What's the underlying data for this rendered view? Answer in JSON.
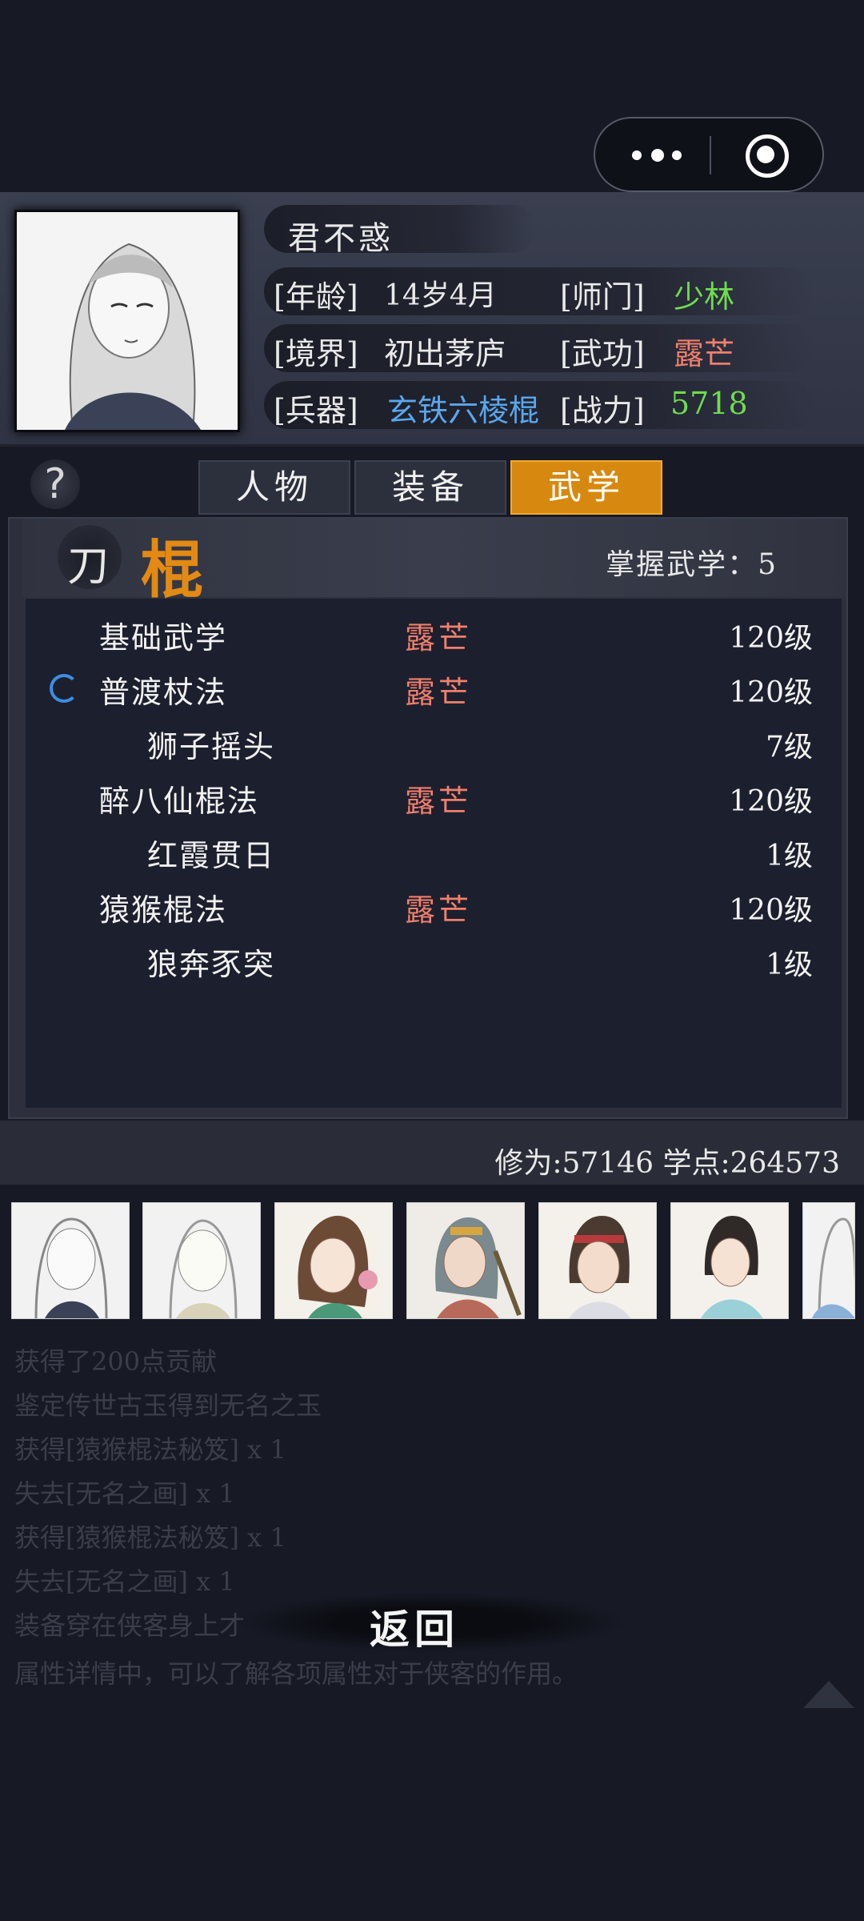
{
  "info": {
    "name": "君不惑",
    "age_label": "[年龄]",
    "age": "14岁4月",
    "sect_label": "[师门]",
    "sect": "少林",
    "realm_label": "[境界]",
    "realm": "初出茅庐",
    "kungfu_label": "[武功]",
    "kungfu": "露芒",
    "weapon_label": "[兵器]",
    "weapon": "玄铁六棱棍",
    "power_label": "[战力]",
    "power": "5718"
  },
  "tabs": [
    "人物",
    "装备",
    "武学"
  ],
  "active_tab": "武学",
  "weapon_types": [
    "刀",
    "棍"
  ],
  "mastered": "掌握武学：5",
  "skills": [
    {
      "name": "基础武学",
      "rank": "露芒",
      "level": "120级"
    },
    {
      "name": "普渡杖法",
      "rank": "露芒",
      "level": "120级"
    },
    {
      "name": "狮子摇头",
      "rank": "",
      "level": "7级"
    },
    {
      "name": "醉八仙棍法",
      "rank": "露芒",
      "level": "120级"
    },
    {
      "name": "红霞贯日",
      "rank": "",
      "level": "1级"
    },
    {
      "name": "猿猴棍法",
      "rank": "露芒",
      "level": "120级"
    },
    {
      "name": "狼奔豕突",
      "rank": "",
      "level": "1级"
    }
  ],
  "stats": "修为:57146  学点:264573",
  "log": [
    "获得了200点贡献",
    "鉴定传世古玉得到无名之玉",
    "获得[猿猴棍法秘笈] x 1",
    "失去[无名之画] x 1",
    "获得[猿猴棍法秘笈] x 1",
    "失去[无名之画] x 1",
    "装备穿在侠客身上才",
    "属性详情中，可以了解各项属性对于侠客的作用。"
  ],
  "back_label": "返回",
  "colors": {
    "accent": "#d7880e",
    "green": "#6fdc4c",
    "red": "#f17f6d",
    "blue": "#5aa7ee"
  },
  "icons": [
    "more-icon",
    "close-target-icon",
    "help-icon",
    "loading-icon",
    "scroll-up-icon"
  ]
}
